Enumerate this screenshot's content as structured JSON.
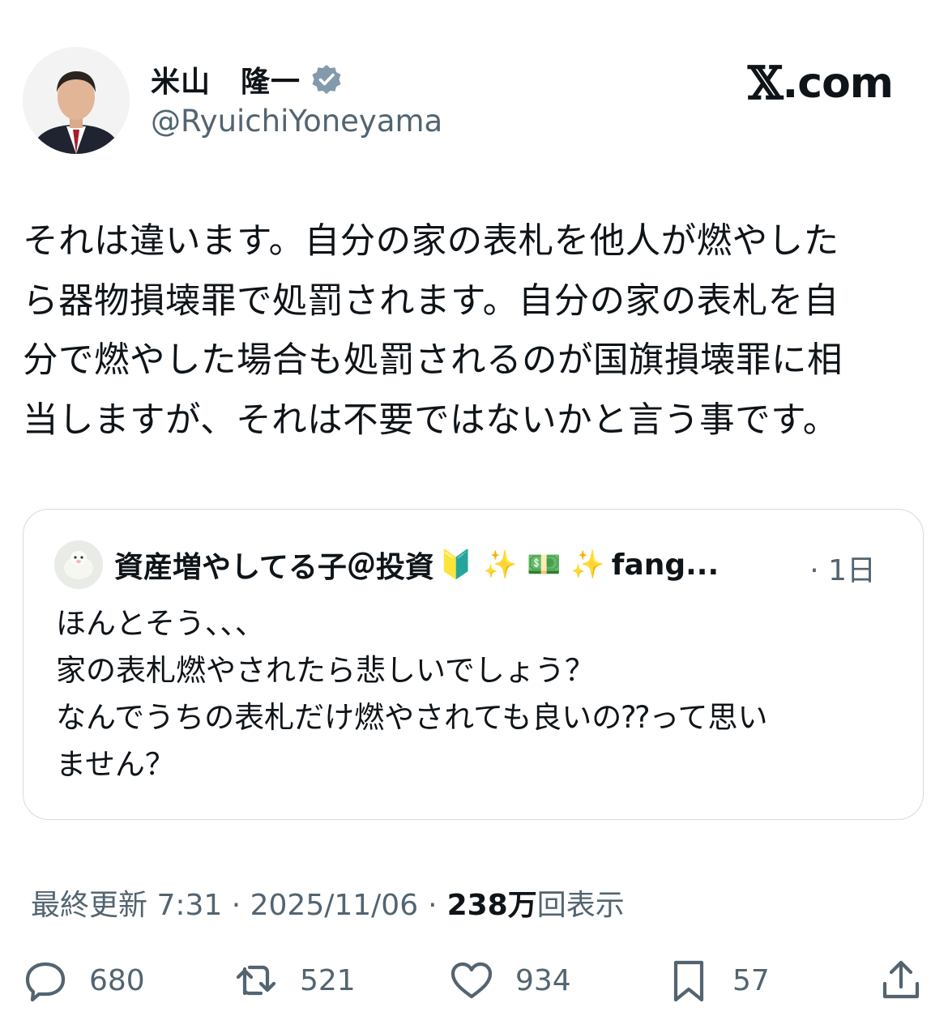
{
  "author": {
    "name": "米山　隆一",
    "handle": "@RyuichiYoneyama",
    "verified_icon": "verified-badge-icon"
  },
  "site_label": {
    "x": "𝕏",
    "rest": ".com"
  },
  "tweet": {
    "lines": [
      "それは違います。自分の家の表札を他人が燃やした",
      "ら器物損壊罪で処罰されます。自分の家の表札を自",
      "分で燃やした場合も処罰されるのが国旗損壊罪に相",
      "当しますが、それは不要ではないかと言う事です。"
    ]
  },
  "quote": {
    "author": "資産増やしてる子＠投資",
    "author_emojis": "🔰 ✨ 💵 ✨",
    "author_suffix": "fang...",
    "meta": "· 1日",
    "lines": [
      "ほんとそう、、、",
      "家の表札燃やされたら悲しいでしょう？",
      "なんでうちの表札だけ燃やされても良いの⁇って思い",
      "ません？"
    ]
  },
  "meta": {
    "updated": "最終更新 7:31 · 2025/11/06",
    "sep": "·",
    "views_number": "238万",
    "views_label": "回表示"
  },
  "actions": {
    "replies": "680",
    "retweets": "521",
    "likes": "934",
    "bookmarks": "57"
  },
  "colors": {
    "text": "#0f1419",
    "secondary": "#536471",
    "border": "#d4dbe0",
    "verified": "#829aab"
  }
}
